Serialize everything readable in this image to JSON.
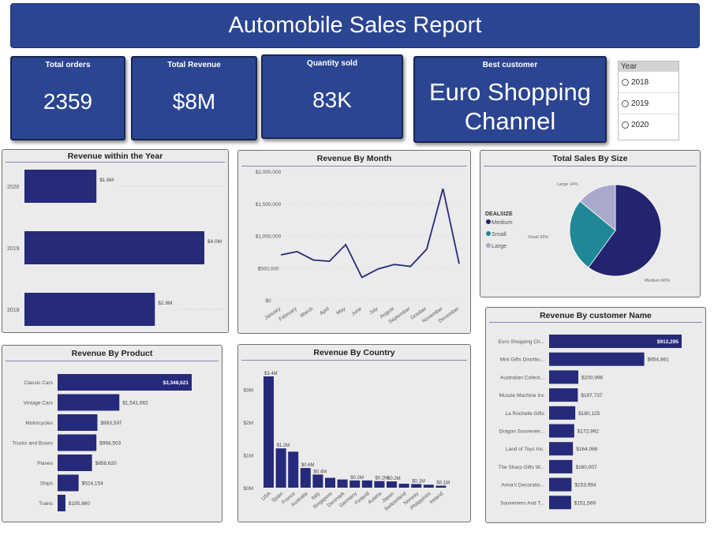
{
  "title": "Automobile Sales Report",
  "kpis": [
    {
      "label": "Total orders",
      "value": "2359"
    },
    {
      "label": "Total Revenue",
      "value": "$8M"
    },
    {
      "label": "Quantity sold",
      "value": "83K"
    },
    {
      "label": "Best customer",
      "value_line1": "Euro Shopping",
      "value_line2": "Channel"
    }
  ],
  "slicer": {
    "header": "Year",
    "options": [
      "2018",
      "2019",
      "2020"
    ]
  },
  "colors": {
    "bar": "#262a7a",
    "medium": "#232470",
    "small": "#1e8896",
    "large": "#a9a9cc",
    "kpi": "#2b4592"
  },
  "panels": {
    "revenue_year": "Revenue within the Year",
    "revenue_month": "Revenue By Month",
    "sales_size": "Total Sales By Size",
    "revenue_product": "Revenue By Product",
    "revenue_country": "Revenue By Country",
    "revenue_customer": "Revenue By customer Name"
  },
  "chart_data": [
    {
      "id": "year",
      "type": "bar",
      "orientation": "horizontal",
      "title": "Revenue within the Year",
      "categories": [
        "2020",
        "2019",
        "2018"
      ],
      "values": [
        1.6,
        4.0,
        2.9
      ],
      "labels": [
        "$1.6M",
        "$4.0M",
        "$2.9M"
      ],
      "xlim": [
        0,
        4.0
      ]
    },
    {
      "id": "month",
      "type": "line",
      "title": "Revenue By Month",
      "categories": [
        "January",
        "February",
        "March",
        "April",
        "May",
        "June",
        "July",
        "August",
        "September",
        "October",
        "November",
        "December"
      ],
      "values": [
        700000,
        750000,
        620000,
        600000,
        860000,
        350000,
        480000,
        550000,
        520000,
        790000,
        1730000,
        560000
      ],
      "yticks": [
        "$0",
        "$500,000",
        "$1,000,000",
        "$1,500,000",
        "$2,000,000"
      ],
      "ylim": [
        0,
        2000000
      ]
    },
    {
      "id": "size",
      "type": "pie",
      "title": "Total Sales By Size",
      "legend_title": "DEALSIZE",
      "legend": [
        "Medium",
        "Small",
        "Large"
      ],
      "slices": [
        {
          "name": "Medium",
          "value": 60,
          "label": "Medium 60%"
        },
        {
          "name": "Small",
          "value": 26,
          "label": "Small 26%"
        },
        {
          "name": "Large",
          "value": 14,
          "label": "Large 14%"
        }
      ]
    },
    {
      "id": "product",
      "type": "bar",
      "orientation": "horizontal",
      "title": "Revenue By Product",
      "categories": [
        "Classic Cars",
        "Vintage Cars",
        "Motorcycles",
        "Trucks and Buses",
        "Planes",
        "Ships",
        "Trains"
      ],
      "values": [
        3348621,
        1541662,
        993597,
        968503,
        858620,
        524154,
        195660
      ],
      "labels": [
        "$3,348,621",
        "$1,541,662",
        "$993,597",
        "$968,503",
        "$858,620",
        "$524,154",
        "$195,660"
      ],
      "xlim": [
        0,
        3348621
      ]
    },
    {
      "id": "country",
      "type": "bar",
      "title": "Revenue By Country",
      "categories": [
        "USA",
        "Spain",
        "France",
        "Australia",
        "Italy",
        "Singapore",
        "Denmark",
        "Germany",
        "Finland",
        "Austria",
        "Japan",
        "Switzerland",
        "Norway",
        "Philippines",
        "Ireland"
      ],
      "values": [
        3.4,
        1.2,
        1.1,
        0.6,
        0.4,
        0.3,
        0.25,
        0.22,
        0.22,
        0.2,
        0.19,
        0.12,
        0.11,
        0.09,
        0.06
      ],
      "labels": [
        "$3.4M",
        "$1.2M",
        "",
        "$0.6M",
        "$0.4M",
        "",
        "",
        "$0.2M",
        "",
        "$0.2M",
        "$0.2M",
        "",
        "$0.1M",
        "",
        "$0.1M"
      ],
      "yticks": [
        "$0M",
        "$1M",
        "$2M",
        "$3M"
      ],
      "ylim": [
        0,
        3.4
      ]
    },
    {
      "id": "customer",
      "type": "bar",
      "orientation": "horizontal",
      "title": "Revenue By customer Name",
      "categories": [
        "Euro Shopping Ch...",
        "Mini Gifts Distribu...",
        "Australian Collect...",
        "Muscle Machine Inc",
        "La Rochelle Gifts",
        "Dragon Souvenier...",
        "Land of Toys Inc.",
        "The Sharp Gifts W...",
        "Anna's Decoratio...",
        "Souveniers And T..."
      ],
      "values": [
        912295,
        654861,
        200996,
        197737,
        180125,
        172992,
        164068,
        160007,
        153994,
        151569
      ],
      "labels": [
        "$912,295",
        "$654,861",
        "$200,996",
        "$197,737",
        "$180,125",
        "$172,992",
        "$164,068",
        "$160,007",
        "$153,994",
        "$151,569"
      ],
      "xlim": [
        0,
        912295
      ]
    }
  ]
}
